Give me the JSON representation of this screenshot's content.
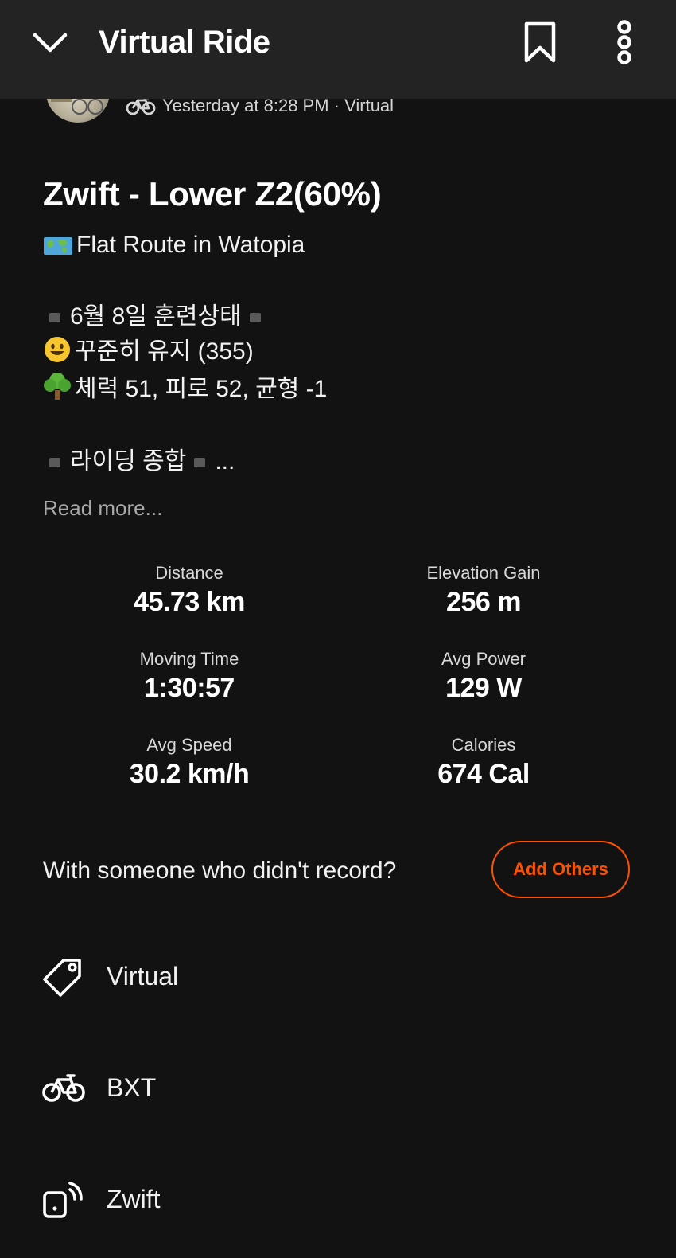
{
  "header": {
    "title": "Virtual Ride"
  },
  "meta": {
    "text": "Yesterday at 8:28 PM · Virtual"
  },
  "activity": {
    "title": "Zwift - Lower Z2(60%)",
    "route_line": "Flat Route in Watopia",
    "training_heading": "6월 8일 훈련상태",
    "status_line": "꾸준히 유지 (355)",
    "fitness_line": "체력 51, 피로 52, 균형 -1",
    "riding_heading": "라이딩 종합",
    "riding_ellipsis": "...",
    "read_more": "Read more..."
  },
  "stats": [
    {
      "label": "Distance",
      "value": "45.73 km"
    },
    {
      "label": "Elevation Gain",
      "value": "256 m"
    },
    {
      "label": "Moving Time",
      "value": "1:30:57"
    },
    {
      "label": "Avg Power",
      "value": "129 W"
    },
    {
      "label": "Avg Speed",
      "value": "30.2 km/h"
    },
    {
      "label": "Calories",
      "value": "674 Cal"
    }
  ],
  "with_others": {
    "prompt": "With someone who didn't record?",
    "button": "Add Others"
  },
  "details": [
    {
      "icon": "tag-icon",
      "label": "Virtual"
    },
    {
      "icon": "bike-icon",
      "label": "BXT"
    },
    {
      "icon": "device-connected-icon",
      "label": "Zwift"
    }
  ],
  "colors": {
    "accent": "#fc5200",
    "background": "#121212",
    "header": "#232323"
  }
}
